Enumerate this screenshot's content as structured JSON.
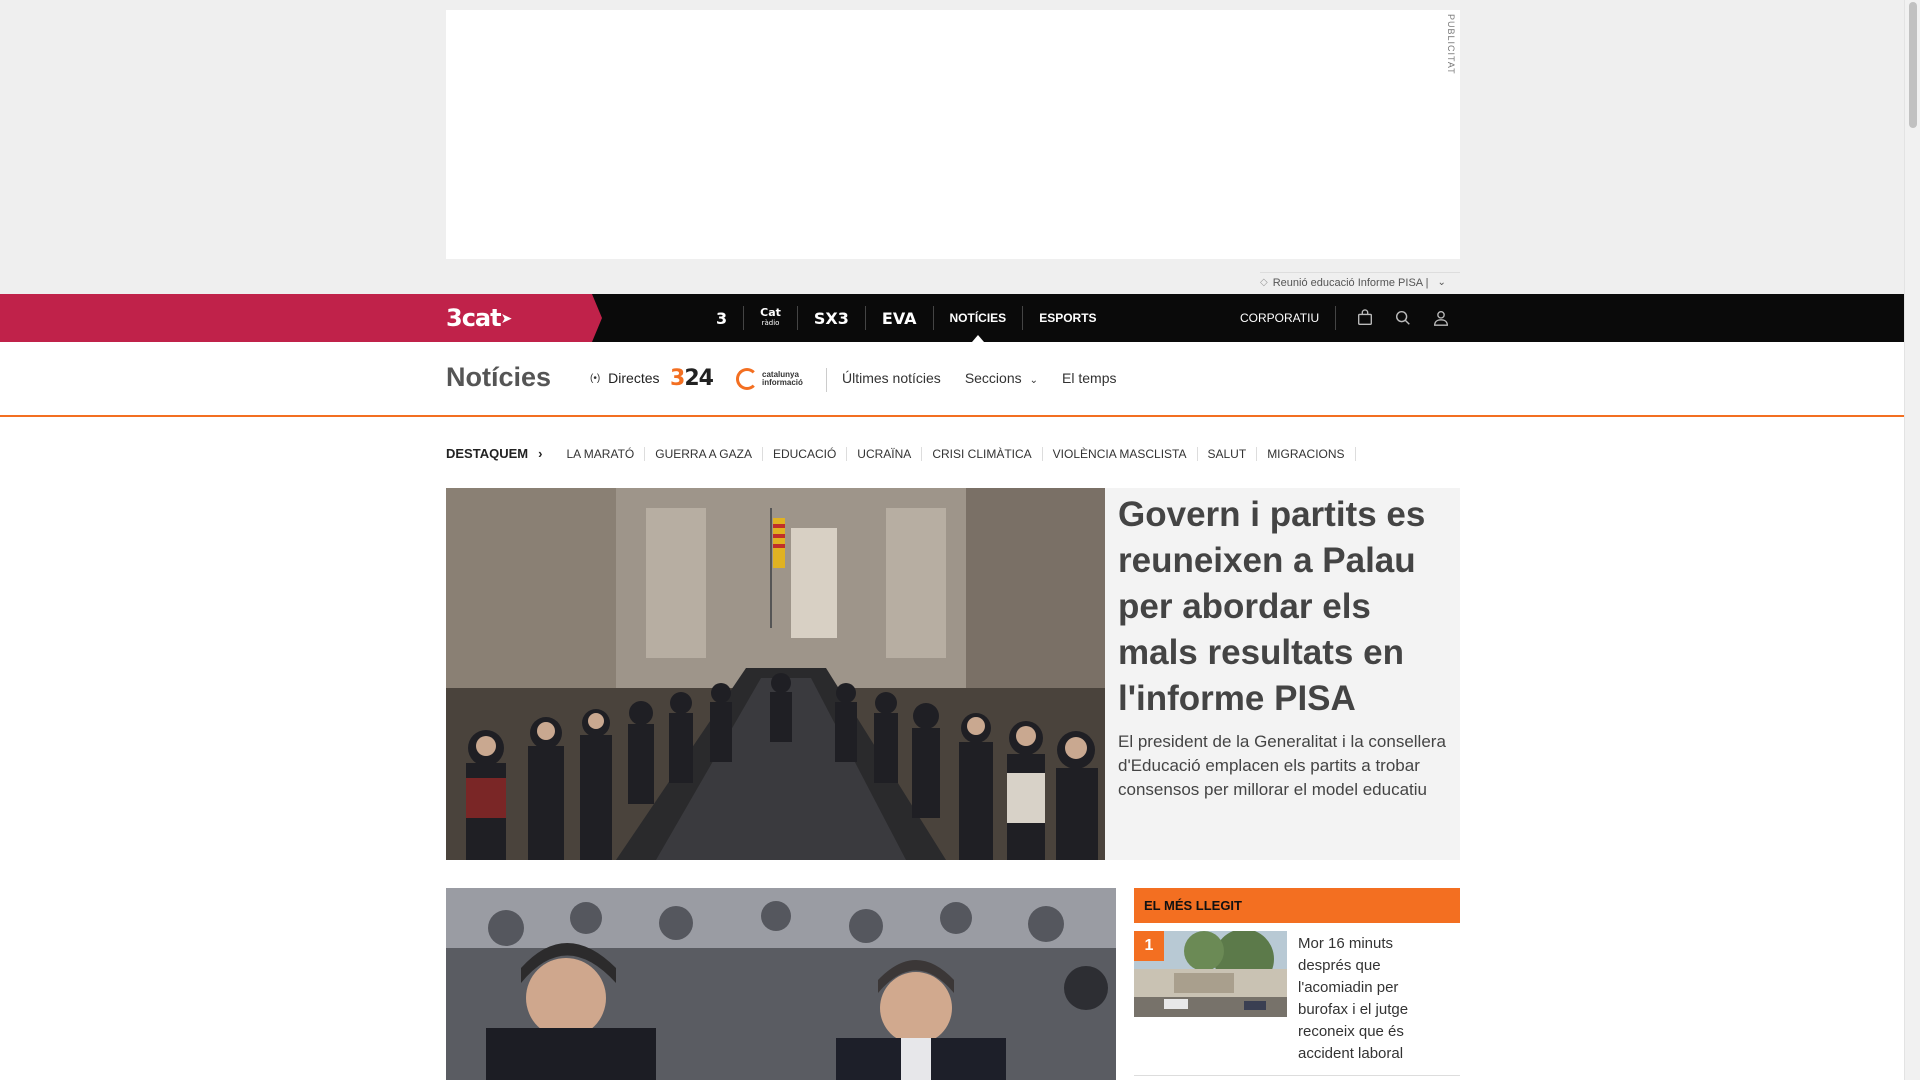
{
  "ad": {
    "label": "PUBLICITAT",
    "ticker_text": "Reunió educació Informe PISA |"
  },
  "topnav": {
    "brand": "3cat",
    "channels": [
      {
        "label": "3"
      },
      {
        "label": "Cat",
        "sub": "ràdio"
      },
      {
        "label": "SX3"
      },
      {
        "label": "EVA"
      }
    ],
    "links": [
      {
        "label": "NOTÍCIES",
        "active": true
      },
      {
        "label": "ESPORTS",
        "active": false
      }
    ],
    "corporate": "CORPORATIU"
  },
  "section": {
    "title": "Notícies",
    "directes": "Directes",
    "logo_324": {
      "a": "3",
      "b": "24"
    },
    "logo_ci": {
      "line1": "catalunya",
      "line2": "informació"
    },
    "links": [
      "Últimes notícies",
      "Seccions",
      "El temps"
    ]
  },
  "highlights": {
    "lead": "DESTAQUEM",
    "items": [
      "LA MARATÓ",
      "GUERRA A GAZA",
      "EDUCACIÓ",
      "UCRAÏNA",
      "CRISI CLIMÀTICA",
      "VIOLÈNCIA MASCLISTA",
      "SALUT",
      "MIGRACIONS"
    ]
  },
  "main_story": {
    "headline": "Govern i partits es reuneixen a Palau per abordar els mals resultats en l'informe PISA",
    "standfirst": "El president de la Generalitat i la consellera d'Educació emplacen els partits a trobar consensos per millorar el model educatiu"
  },
  "most_read": {
    "title": "EL MÉS LLEGIT",
    "items": [
      {
        "rank": "1",
        "title": "Mor 16 minuts després que l'acomiadin per burofax i el jutge reconeix que és accident laboral"
      }
    ]
  },
  "colors": {
    "brand": "#c0224a",
    "accent": "#f36f21",
    "nav_bg": "#0a0a0a"
  }
}
